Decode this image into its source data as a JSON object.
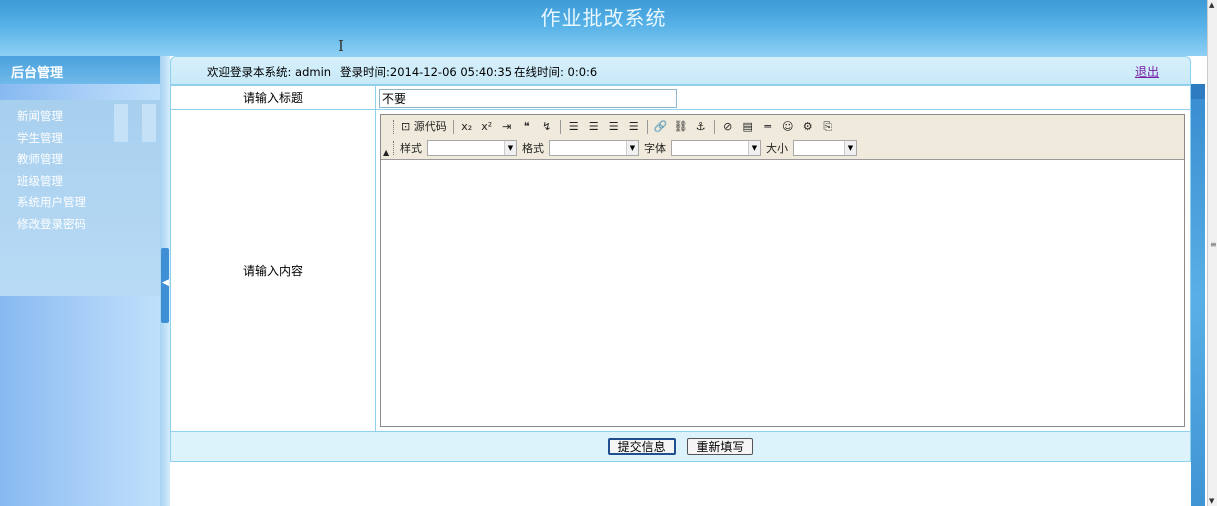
{
  "app": {
    "title": "作业批改系统"
  },
  "sidebar": {
    "header": "后台管理",
    "items": [
      {
        "label": "新闻管理"
      },
      {
        "label": "学生管理"
      },
      {
        "label": "教师管理"
      },
      {
        "label": "班级管理"
      },
      {
        "label": "系统用户管理"
      },
      {
        "label": "修改登录密码"
      }
    ]
  },
  "infobar": {
    "welcome": "欢迎登录本系统: admin",
    "login_time": "登录时间:2014-12-06 05:40:35",
    "online_time": "在线时间: 0:0:6",
    "logout": "退出"
  },
  "form": {
    "title_label": "请输入标题",
    "title_value": "不要",
    "content_label": "请输入内容",
    "submit": "提交信息",
    "reset": "重新填写"
  },
  "editor": {
    "source_label": "源代码",
    "style_label": "样式",
    "format_label": "格式",
    "font_label": "字体",
    "size_label": "大小",
    "style_value": "",
    "format_value": "",
    "font_value": "",
    "size_value": ""
  }
}
